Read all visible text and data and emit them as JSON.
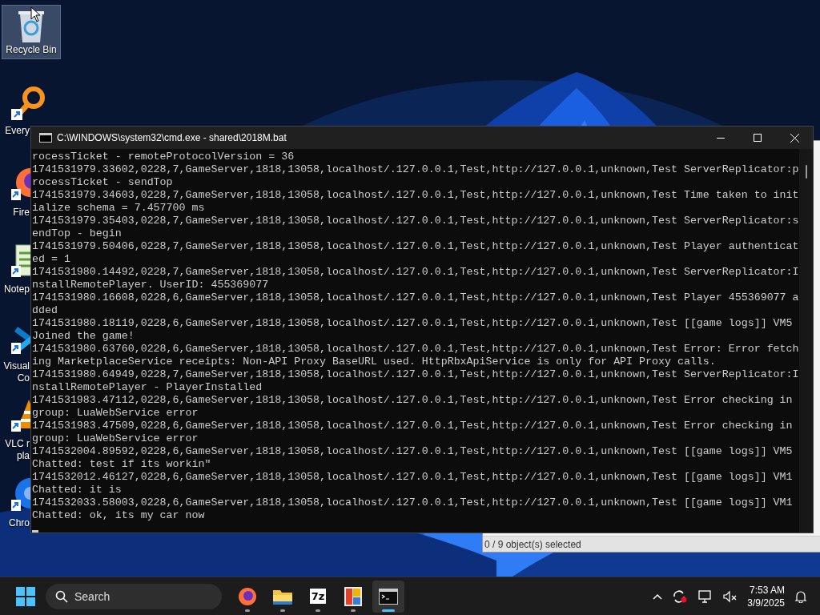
{
  "desktop_icons": [
    {
      "kind": "recycle-bin",
      "label": [
        "Recycle Bin"
      ],
      "selected": true
    },
    {
      "kind": "magnifier",
      "label": [
        "Every"
      ],
      "selected": false
    },
    {
      "kind": "fox",
      "label": [
        "Fire"
      ],
      "selected": false
    },
    {
      "kind": "notepad",
      "label": [
        "Notep"
      ],
      "selected": false
    },
    {
      "kind": "ribbon",
      "label": [
        "Visual",
        "Co"
      ],
      "selected": false
    },
    {
      "kind": "cone",
      "label": [
        "VLC r",
        "pla"
      ],
      "selected": false
    },
    {
      "kind": "ring",
      "label": [
        "Chro"
      ],
      "selected": false
    }
  ],
  "background_window": {
    "status": "0 / 9 object(s) selected"
  },
  "console": {
    "title": "C:\\WINDOWS\\system32\\cmd.exe - shared\\2018M.bat",
    "lines": [
      "rocessTicket - remoteProtocolVersion = 36",
      "1741531979.33602,0228,7,GameServer,1818,13058,localhost/.127.0.0.1,Test,http://127.0.0.1,unknown,Test ServerReplicator:p",
      "rocessTicket - sendTop",
      "1741531979.34603,0228,7,GameServer,1818,13058,localhost/.127.0.0.1,Test,http://127.0.0.1,unknown,Test Time taken to init",
      "ialize schema = 7.457700 ms",
      "1741531979.35403,0228,7,GameServer,1818,13058,localhost/.127.0.0.1,Test,http://127.0.0.1,unknown,Test ServerReplicator:s",
      "endTop - begin",
      "1741531979.50406,0228,7,GameServer,1818,13058,localhost/.127.0.0.1,Test,http://127.0.0.1,unknown,Test Player authenticat",
      "ed = 1",
      "1741531980.14492,0228,7,GameServer,1818,13058,localhost/.127.0.0.1,Test,http://127.0.0.1,unknown,Test ServerReplicator:I",
      "nstallRemotePlayer. UserID: 455369077",
      "1741531980.16608,0228,6,GameServer,1818,13058,localhost/.127.0.0.1,Test,http://127.0.0.1,unknown,Test Player 455369077 a",
      "dded",
      "1741531980.18119,0228,6,GameServer,1818,13058,localhost/.127.0.0.1,Test,http://127.0.0.1,unknown,Test [[game logs]] VM5",
      "Joined the game!",
      "1741531980.63760,0228,6,GameServer,1818,13058,localhost/.127.0.0.1,Test,http://127.0.0.1,unknown,Test Error: Error fetch",
      "ing MarketplaceService receipts: Non-API Proxy BaseURL used. HttpRbxApiService is only for API Proxy calls.",
      "1741531980.64949,0228,7,GameServer,1818,13058,localhost/.127.0.0.1,Test,http://127.0.0.1,unknown,Test ServerReplicator:I",
      "nstallRemotePlayer - PlayerInstalled",
      "1741531983.47112,0228,6,GameServer,1818,13058,localhost/.127.0.0.1,Test,http://127.0.0.1,unknown,Test Error checking in",
      "group: LuaWebService error",
      "1741531983.47509,0228,6,GameServer,1818,13058,localhost/.127.0.0.1,Test,http://127.0.0.1,unknown,Test Error checking in",
      "group: LuaWebService error",
      "1741532004.89592,0228,6,GameServer,1818,13058,localhost/.127.0.0.1,Test,http://127.0.0.1,unknown,Test [[game logs]] VM5",
      "Chatted: test if its workin\"",
      "1741532012.46127,0228,6,GameServer,1818,13058,localhost/.127.0.0.1,Test,http://127.0.0.1,unknown,Test [[game logs]] VM1",
      "Chatted: it is",
      "1741532033.58003,0228,6,GameServer,1818,13058,localhost/.127.0.0.1,Test,http://127.0.0.1,unknown,Test [[game logs]] VM1",
      "Chatted: ok, its my car now"
    ]
  },
  "taskbar": {
    "search": {
      "placeholder": "Search"
    },
    "apps": [
      {
        "kind": "fox",
        "active": false
      },
      {
        "kind": "folder",
        "active": false
      },
      {
        "kind": "archiver",
        "text": "7z",
        "active": false
      },
      {
        "kind": "photos",
        "active": false
      },
      {
        "kind": "terminal",
        "active": true
      }
    ],
    "time": "7:53 AM",
    "date": "3/9/2025"
  }
}
